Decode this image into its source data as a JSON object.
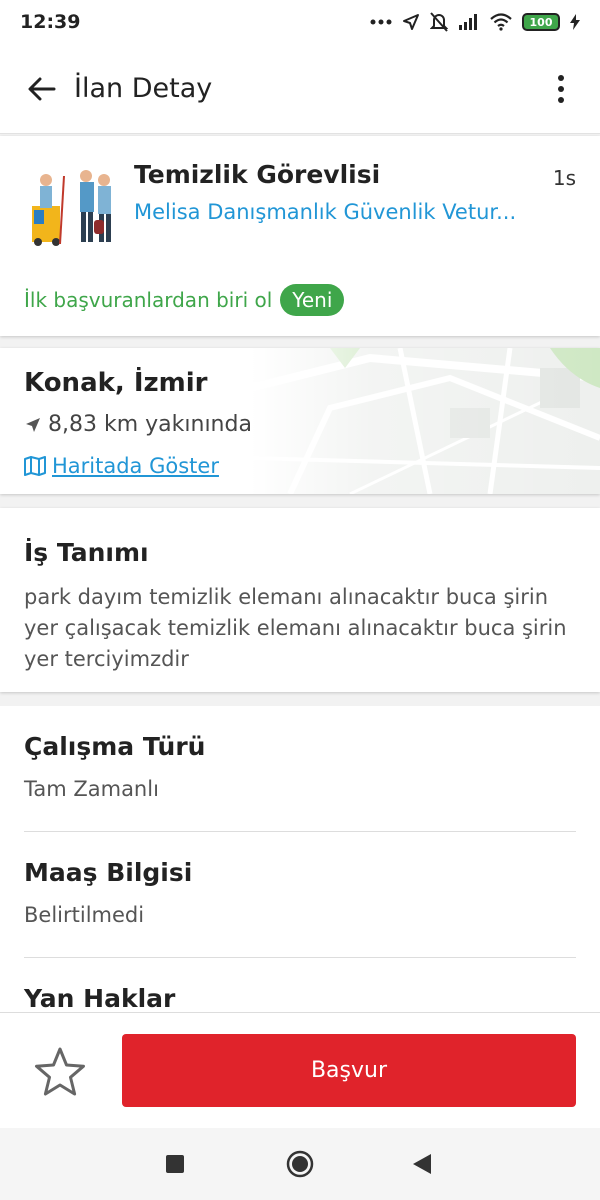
{
  "status_bar": {
    "time": "12:39",
    "battery": "100"
  },
  "app_bar": {
    "title": "İlan Detay"
  },
  "job": {
    "title": "Temizlik Görevlisi",
    "age": "1s",
    "company": "Melisa Danışmanlık Güvenlik Vetur...",
    "early_text": "İlk başvuranlardan biri ol",
    "badge": "Yeni"
  },
  "location": {
    "city": "Konak, İzmir",
    "distance": "8,83 km yakınında",
    "map_link": "Haritada Göster"
  },
  "description": {
    "title": "İş Tanımı",
    "text": "park dayım temizlik elemanı alınacaktır buca şirin yer çalışacak temizlik elemanı alınacaktır buca şirin yer terciyimzdir"
  },
  "details": {
    "work_type_label": "Çalışma Türü",
    "work_type_value": "Tam Zamanlı",
    "salary_label": "Maaş Bilgisi",
    "salary_value": "Belirtilmedi",
    "benefits_label": "Yan Haklar"
  },
  "actions": {
    "apply_label": "Başvur"
  },
  "colors": {
    "accent_red": "#e0232b",
    "link_blue": "#2196d6",
    "success_green": "#3fa64a"
  }
}
